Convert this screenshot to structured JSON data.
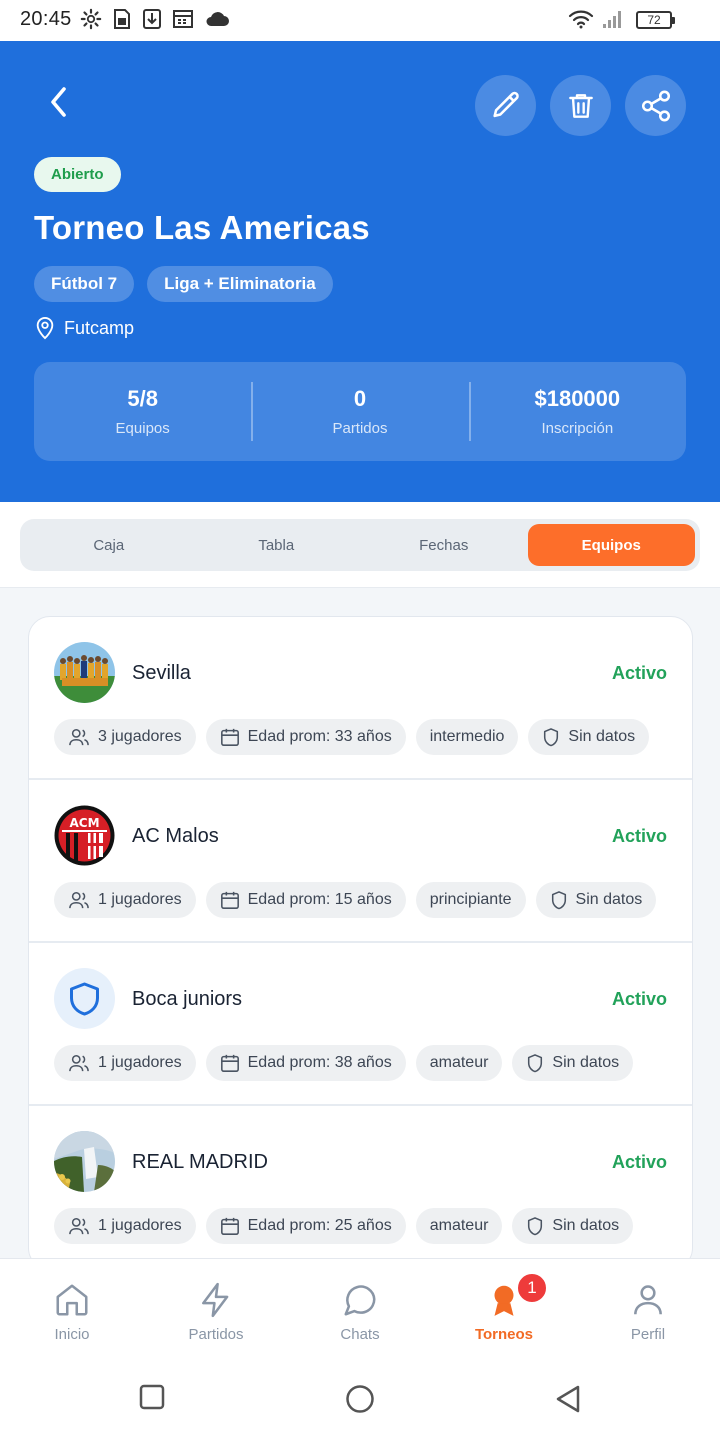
{
  "status_bar": {
    "time": "20:45",
    "battery": "72"
  },
  "header": {
    "status": "Abierto",
    "title": "Torneo Las Americas",
    "chips": [
      "Fútbol 7",
      "Liga + Eliminatoria"
    ],
    "location": "Futcamp",
    "stats": [
      {
        "value": "5/8",
        "label": "Equipos"
      },
      {
        "value": "0",
        "label": "Partidos"
      },
      {
        "value": "$180000",
        "label": "Inscripción"
      }
    ]
  },
  "tabs": [
    {
      "label": "Caja",
      "active": false
    },
    {
      "label": "Tabla",
      "active": false
    },
    {
      "label": "Fechas",
      "active": false
    },
    {
      "label": "Equipos",
      "active": true
    }
  ],
  "teams": [
    {
      "name": "Sevilla",
      "status": "Activo",
      "players": "3 jugadores",
      "age": "Edad prom: 33 años",
      "level": "intermedio",
      "data": "Sin datos",
      "avatar": "team-photo"
    },
    {
      "name": "AC Malos",
      "status": "Activo",
      "players": "1 jugadores",
      "age": "Edad prom: 15 años",
      "level": "principiante",
      "data": "Sin datos",
      "avatar": "acm-crest"
    },
    {
      "name": "Boca juniors",
      "status": "Activo",
      "players": "1 jugadores",
      "age": "Edad prom: 38 años",
      "level": "amateur",
      "data": "Sin datos",
      "avatar": "shield-placeholder"
    },
    {
      "name": "REAL MADRID",
      "status": "Activo",
      "players": "1 jugadores",
      "age": "Edad prom: 25 años",
      "level": "amateur",
      "data": "Sin datos",
      "avatar": "waterfall-photo"
    }
  ],
  "bottom_nav": [
    {
      "label": "Inicio",
      "icon": "home-icon",
      "active": false
    },
    {
      "label": "Partidos",
      "icon": "lightning-icon",
      "active": false
    },
    {
      "label": "Chats",
      "icon": "chat-icon",
      "active": false
    },
    {
      "label": "Torneos",
      "icon": "award-icon",
      "active": true,
      "badge": "1"
    },
    {
      "label": "Perfil",
      "icon": "user-icon",
      "active": false
    }
  ],
  "colors": {
    "primary": "#1f6fdc",
    "accent": "#fd6e2a",
    "success": "#22a25a",
    "badge": "#ee3b3b"
  }
}
